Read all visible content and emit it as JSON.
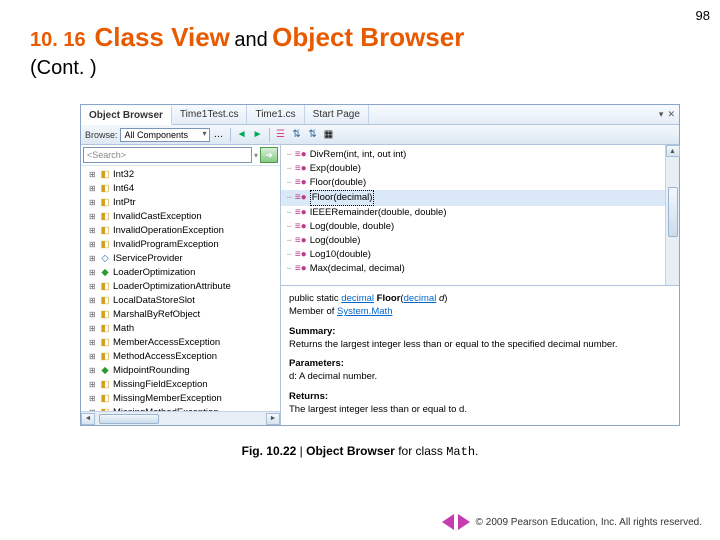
{
  "page_number": "98",
  "heading": {
    "section": "10. 16",
    "part1": "Class View",
    "and": "and",
    "part2": "Object Browser",
    "cont": "(Cont. )"
  },
  "tabs": [
    "Object Browser",
    "Time1Test.cs",
    "Time1.cs",
    "Start Page"
  ],
  "browse_label": "Browse:",
  "browse_value": "All Components",
  "search_placeholder": "<Search>",
  "tree_items": [
    {
      "icon": "yellow",
      "label": "Int32"
    },
    {
      "icon": "yellow",
      "label": "Int64"
    },
    {
      "icon": "yellow",
      "label": "IntPtr"
    },
    {
      "icon": "yellow",
      "label": "InvalidCastException"
    },
    {
      "icon": "yellow",
      "label": "InvalidOperationException"
    },
    {
      "icon": "yellow",
      "label": "InvalidProgramException"
    },
    {
      "icon": "blue",
      "label": "IServiceProvider"
    },
    {
      "icon": "green",
      "label": "LoaderOptimization"
    },
    {
      "icon": "yellow",
      "label": "LoaderOptimizationAttribute"
    },
    {
      "icon": "yellow",
      "label": "LocalDataStoreSlot"
    },
    {
      "icon": "yellow",
      "label": "MarshalByRefObject"
    },
    {
      "icon": "yellow",
      "label": "Math"
    },
    {
      "icon": "yellow",
      "label": "MemberAccessException"
    },
    {
      "icon": "yellow",
      "label": "MethodAccessException"
    },
    {
      "icon": "green",
      "label": "MidpointRounding"
    },
    {
      "icon": "yellow",
      "label": "MissingFieldException"
    },
    {
      "icon": "yellow",
      "label": "MissingMemberException"
    },
    {
      "icon": "yellow",
      "label": "MissingMethodException"
    }
  ],
  "members": [
    {
      "label": "DivRem(int, int, out int)"
    },
    {
      "label": "Exp(double)"
    },
    {
      "label": "Floor(double)"
    },
    {
      "label": "Floor(decimal)",
      "selected": true
    },
    {
      "label": "IEEERemainder(double, double)"
    },
    {
      "label": "Log(double, double)"
    },
    {
      "label": "Log(double)"
    },
    {
      "label": "Log10(double)"
    },
    {
      "label": "Max(decimal, decimal)"
    }
  ],
  "detail": {
    "sig_prefix": "public static",
    "sig_type": "decimal",
    "sig_name": "Floor",
    "sig_param_type": "decimal",
    "sig_param_name": "d",
    "member_of_prefix": "Member of",
    "member_of_link": "System.Math",
    "summary_h": "Summary:",
    "summary": "Returns the largest integer less than or equal to the specified decimal number.",
    "params_h": "Parameters:",
    "params": "d: A decimal number.",
    "returns_h": "Returns:",
    "returns": "The largest integer less than or equal to d."
  },
  "caption": {
    "fig": "Fig. 10.22",
    "sep": "|",
    "ob": "Object Browser",
    "for": "for class",
    "cls": "Math",
    "dot": "."
  },
  "copyright": "© 2009 Pearson Education, Inc.  All rights reserved."
}
